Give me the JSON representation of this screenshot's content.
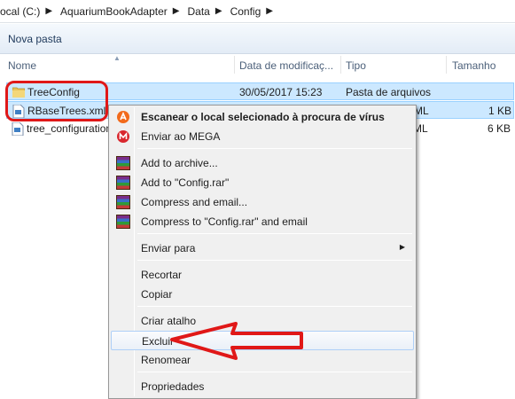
{
  "breadcrumb": [
    "ocal (C:)",
    "AquariumBookAdapter",
    "Data",
    "Config"
  ],
  "toolbar": {
    "new_folder": "Nova pasta"
  },
  "columns": {
    "name": "Nome",
    "date": "Data de modificaç...",
    "type": "Tipo",
    "size": "Tamanho"
  },
  "files": [
    {
      "name": "TreeConfig",
      "date": "30/05/2017 15:23",
      "type": "Pasta de arquivos",
      "size": ""
    },
    {
      "name": "RBaseTrees.xml",
      "date": "",
      "type": "ML",
      "size": "1 KB"
    },
    {
      "name": "tree_configuration",
      "date": "",
      "type": "ML",
      "size": "6 KB"
    }
  ],
  "context_menu": {
    "scan": "Escanear o local selecionado à procura de vírus",
    "mega": "Enviar ao MEGA",
    "add_archive": "Add to archive...",
    "add_config_rar": "Add to \"Config.rar\"",
    "compress_email": "Compress and email...",
    "compress_config_email": "Compress to \"Config.rar\" and email",
    "send_to": "Enviar para",
    "cut": "Recortar",
    "copy": "Copiar",
    "shortcut": "Criar atalho",
    "delete": "Excluir",
    "rename": "Renomear",
    "properties": "Propriedades"
  },
  "colors": {
    "annotation": "#e01818",
    "selection": "#cce8ff"
  }
}
